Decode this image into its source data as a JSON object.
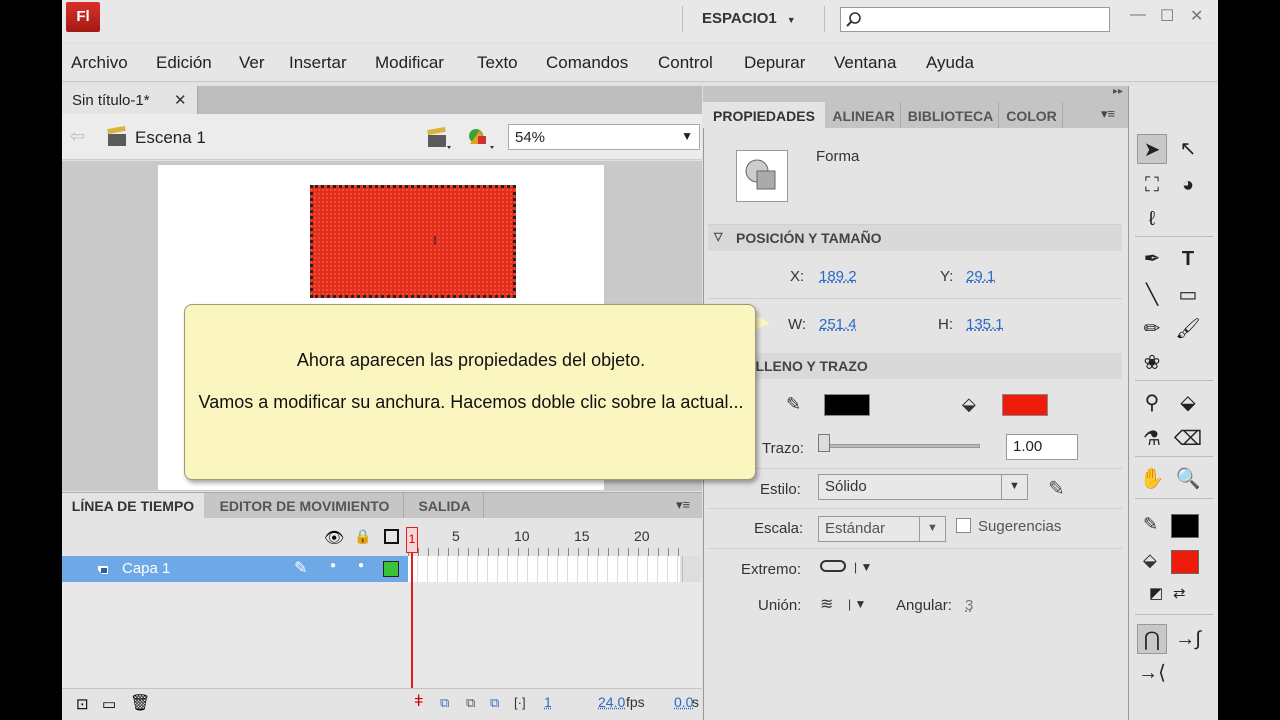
{
  "app": {
    "logo": "Fl",
    "workspace": "ESPACIO1",
    "search_placeholder": ""
  },
  "menu": [
    "Archivo",
    "Edición",
    "Ver",
    "Insertar",
    "Modificar",
    "Texto",
    "Comandos",
    "Control",
    "Depurar",
    "Ventana",
    "Ayuda"
  ],
  "document": {
    "tab": "Sin título-1*",
    "scene": "Escena 1",
    "zoom": "54%"
  },
  "timeline": {
    "tabs": [
      "LÍNEA DE TIEMPO",
      "EDITOR DE MOVIMIENTO",
      "SALIDA"
    ],
    "frame_numbers": [
      "1",
      "5",
      "10",
      "15",
      "20"
    ],
    "layer": "Capa 1",
    "current_frame": "1",
    "fps": "24.0",
    "fps_unit": "fps",
    "time": "0.0",
    "time_unit": "s"
  },
  "properties": {
    "tabs": [
      "PROPIEDADES",
      "ALINEAR",
      "BIBLIOTECA",
      "COLOR"
    ],
    "object_type": "Forma",
    "position_section": "POSICIÓN Y TAMAÑO",
    "x_label": "X:",
    "x": "189.2",
    "y_label": "Y:",
    "y": "29.1",
    "w_label": "W:",
    "w": "251.4",
    "h_label": "H:",
    "h": "135.1",
    "fill_section": "RELLENO Y TRAZO",
    "stroke_color": "#000000",
    "fill_color": "#ee1a0a",
    "stroke_label": "Trazo:",
    "stroke_value": "1.00",
    "style_label": "Estilo:",
    "style_value": "Sólido",
    "scale_label": "Escala:",
    "scale_value": "Estándar",
    "hints_label": "Sugerencias",
    "cap_label": "Extremo:",
    "join_label": "Unión:",
    "miter_label": "Angular:",
    "miter_value": "3"
  },
  "callout": {
    "line1": "Ahora aparecen las propiedades del objeto.",
    "line2": "Vamos a modificar su anchura. Hacemos doble clic sobre la actual..."
  }
}
